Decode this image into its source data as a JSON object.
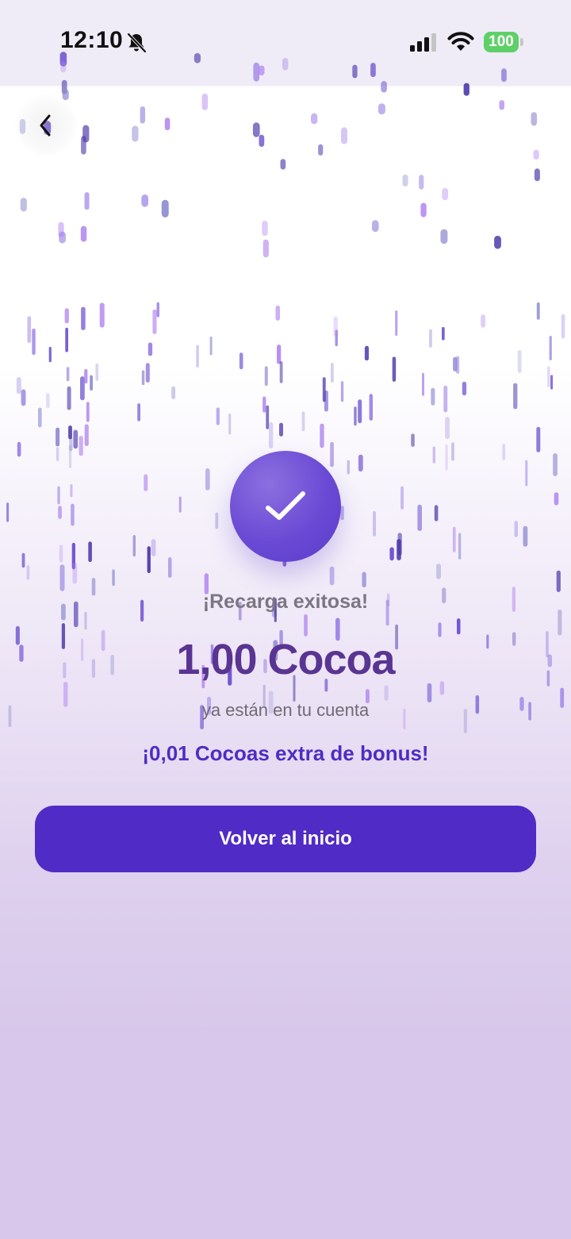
{
  "status_bar": {
    "time": "12:10",
    "battery": "100",
    "icons": [
      "bell-slash-icon",
      "cellular-signal-icon",
      "wifi-icon",
      "battery-icon"
    ]
  },
  "nav": {
    "back_icon": "chevron-left-icon"
  },
  "success": {
    "icon": "checkmark-icon",
    "title": "¡Recarga exitosa!",
    "amount": "1,00 Cocoa",
    "subtitle": "ya están en tu cuenta",
    "bonus": "¡0,01 Cocoas extra de bonus!"
  },
  "actions": {
    "home_button_label": "Volver al inicio"
  },
  "colors": {
    "primary": "#512bc5",
    "amount": "#5a3492",
    "bonus": "#4f2cc2",
    "battery": "#5fd068",
    "confetti": [
      "#6b4fcf",
      "#9a7fe6",
      "#4a36a8",
      "#b488ef",
      "#8d8ad0"
    ]
  }
}
